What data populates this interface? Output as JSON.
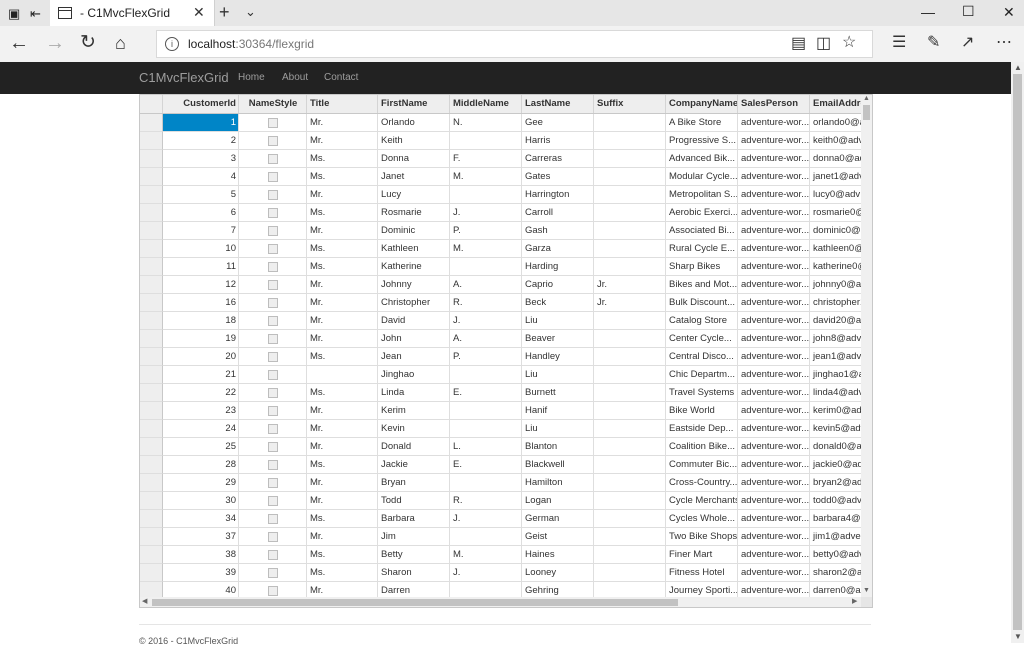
{
  "browser": {
    "tab_title": "- C1MvcFlexGrid",
    "url_host": "localhost",
    "url_rest": ":30364/flexgrid"
  },
  "app": {
    "brand": "C1MvcFlexGrid",
    "nav": [
      "Home",
      "About",
      "Contact"
    ],
    "footer": "© 2016 - C1MvcFlexGrid"
  },
  "grid": {
    "columns": [
      "CustomerId",
      "NameStyle",
      "Title",
      "FirstName",
      "MiddleName",
      "LastName",
      "Suffix",
      "CompanyName",
      "SalesPerson",
      "EmailAddre"
    ],
    "selected_row": 0,
    "rows": [
      {
        "id": "1",
        "title": "Mr.",
        "first": "Orlando",
        "middle": "N.",
        "last": "Gee",
        "suffix": "",
        "company": "A Bike Store",
        "sales": "adventure-wor...",
        "email": "orlando0@a"
      },
      {
        "id": "2",
        "title": "Mr.",
        "first": "Keith",
        "middle": "",
        "last": "Harris",
        "suffix": "",
        "company": "Progressive S...",
        "sales": "adventure-wor...",
        "email": "keith0@adv"
      },
      {
        "id": "3",
        "title": "Ms.",
        "first": "Donna",
        "middle": "F.",
        "last": "Carreras",
        "suffix": "",
        "company": "Advanced Bik...",
        "sales": "adventure-wor...",
        "email": "donna0@adv"
      },
      {
        "id": "4",
        "title": "Ms.",
        "first": "Janet",
        "middle": "M.",
        "last": "Gates",
        "suffix": "",
        "company": "Modular Cycle...",
        "sales": "adventure-wor...",
        "email": "janet1@adv"
      },
      {
        "id": "5",
        "title": "Mr.",
        "first": "Lucy",
        "middle": "",
        "last": "Harrington",
        "suffix": "",
        "company": "Metropolitan S...",
        "sales": "adventure-wor...",
        "email": "lucy0@adv"
      },
      {
        "id": "6",
        "title": "Ms.",
        "first": "Rosmarie",
        "middle": "J.",
        "last": "Carroll",
        "suffix": "",
        "company": "Aerobic Exerci...",
        "sales": "adventure-wor...",
        "email": "rosmarie0@"
      },
      {
        "id": "7",
        "title": "Mr.",
        "first": "Dominic",
        "middle": "P.",
        "last": "Gash",
        "suffix": "",
        "company": "Associated Bi...",
        "sales": "adventure-wor...",
        "email": "dominic0@a"
      },
      {
        "id": "10",
        "title": "Ms.",
        "first": "Kathleen",
        "middle": "M.",
        "last": "Garza",
        "suffix": "",
        "company": "Rural Cycle E...",
        "sales": "adventure-wor...",
        "email": "kathleen0@"
      },
      {
        "id": "11",
        "title": "Ms.",
        "first": "Katherine",
        "middle": "",
        "last": "Harding",
        "suffix": "",
        "company": "Sharp Bikes",
        "sales": "adventure-wor...",
        "email": "katherine0@"
      },
      {
        "id": "12",
        "title": "Mr.",
        "first": "Johnny",
        "middle": "A.",
        "last": "Caprio",
        "suffix": "Jr.",
        "company": "Bikes and Mot...",
        "sales": "adventure-wor...",
        "email": "johnny0@a"
      },
      {
        "id": "16",
        "title": "Mr.",
        "first": "Christopher",
        "middle": "R.",
        "last": "Beck",
        "suffix": "Jr.",
        "company": "Bulk Discount...",
        "sales": "adventure-wor...",
        "email": "christopher1"
      },
      {
        "id": "18",
        "title": "Mr.",
        "first": "David",
        "middle": "J.",
        "last": "Liu",
        "suffix": "",
        "company": "Catalog Store",
        "sales": "adventure-wor...",
        "email": "david20@a"
      },
      {
        "id": "19",
        "title": "Mr.",
        "first": "John",
        "middle": "A.",
        "last": "Beaver",
        "suffix": "",
        "company": "Center Cycle...",
        "sales": "adventure-wor...",
        "email": "john8@adve"
      },
      {
        "id": "20",
        "title": "Ms.",
        "first": "Jean",
        "middle": "P.",
        "last": "Handley",
        "suffix": "",
        "company": "Central Disco...",
        "sales": "adventure-wor...",
        "email": "jean1@adve"
      },
      {
        "id": "21",
        "title": "",
        "first": "Jinghao",
        "middle": "",
        "last": "Liu",
        "suffix": "",
        "company": "Chic Departm...",
        "sales": "adventure-wor...",
        "email": "jinghao1@a"
      },
      {
        "id": "22",
        "title": "Ms.",
        "first": "Linda",
        "middle": "E.",
        "last": "Burnett",
        "suffix": "",
        "company": "Travel Systems",
        "sales": "adventure-wor...",
        "email": "linda4@adv"
      },
      {
        "id": "23",
        "title": "Mr.",
        "first": "Kerim",
        "middle": "",
        "last": "Hanif",
        "suffix": "",
        "company": "Bike World",
        "sales": "adventure-wor...",
        "email": "kerim0@adv"
      },
      {
        "id": "24",
        "title": "Mr.",
        "first": "Kevin",
        "middle": "",
        "last": "Liu",
        "suffix": "",
        "company": "Eastside Dep...",
        "sales": "adventure-wor...",
        "email": "kevin5@adv"
      },
      {
        "id": "25",
        "title": "Mr.",
        "first": "Donald",
        "middle": "L.",
        "last": "Blanton",
        "suffix": "",
        "company": "Coalition Bike...",
        "sales": "adventure-wor...",
        "email": "donald0@a"
      },
      {
        "id": "28",
        "title": "Ms.",
        "first": "Jackie",
        "middle": "E.",
        "last": "Blackwell",
        "suffix": "",
        "company": "Commuter Bic...",
        "sales": "adventure-wor...",
        "email": "jackie0@ad"
      },
      {
        "id": "29",
        "title": "Mr.",
        "first": "Bryan",
        "middle": "",
        "last": "Hamilton",
        "suffix": "",
        "company": "Cross-Country...",
        "sales": "adventure-wor...",
        "email": "bryan2@adv"
      },
      {
        "id": "30",
        "title": "Mr.",
        "first": "Todd",
        "middle": "R.",
        "last": "Logan",
        "suffix": "",
        "company": "Cycle Merchants",
        "sales": "adventure-wor...",
        "email": "todd0@adve"
      },
      {
        "id": "34",
        "title": "Ms.",
        "first": "Barbara",
        "middle": "J.",
        "last": "German",
        "suffix": "",
        "company": "Cycles Whole...",
        "sales": "adventure-wor...",
        "email": "barbara4@a"
      },
      {
        "id": "37",
        "title": "Mr.",
        "first": "Jim",
        "middle": "",
        "last": "Geist",
        "suffix": "",
        "company": "Two Bike Shops",
        "sales": "adventure-wor...",
        "email": "jim1@adven"
      },
      {
        "id": "38",
        "title": "Ms.",
        "first": "Betty",
        "middle": "M.",
        "last": "Haines",
        "suffix": "",
        "company": "Finer Mart",
        "sales": "adventure-wor...",
        "email": "betty0@adv"
      },
      {
        "id": "39",
        "title": "Ms.",
        "first": "Sharon",
        "middle": "J.",
        "last": "Looney",
        "suffix": "",
        "company": "Fitness Hotel",
        "sales": "adventure-wor...",
        "email": "sharon2@ad"
      },
      {
        "id": "40",
        "title": "Mr.",
        "first": "Darren",
        "middle": "",
        "last": "Gehring",
        "suffix": "",
        "company": "Journey Sporti...",
        "sales": "adventure-wor...",
        "email": "darren0@ad"
      }
    ]
  }
}
